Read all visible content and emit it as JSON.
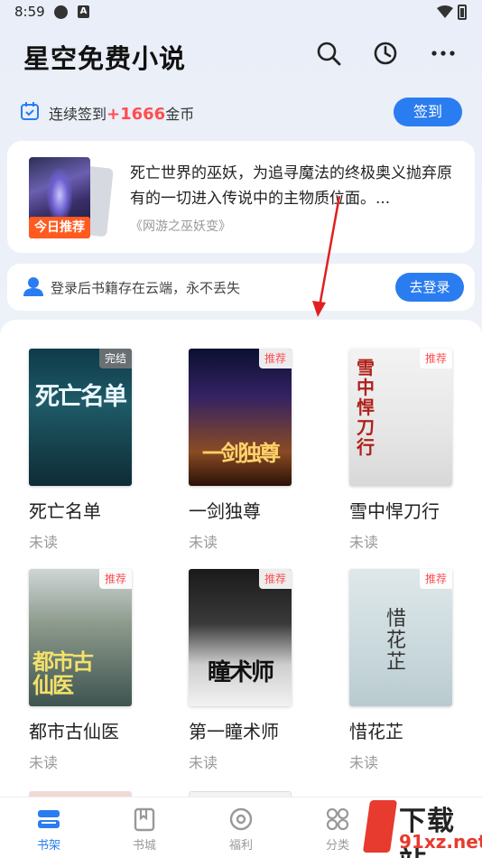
{
  "status_bar": {
    "time": "8:59",
    "notif_icon_1": "globe-icon",
    "notif_icon_2": "A"
  },
  "header": {
    "title": "星空免费小说",
    "icons": [
      "search-icon",
      "history-clock-icon",
      "more-dots-icon"
    ]
  },
  "checkin": {
    "prefix": "连续签到",
    "coins": "+1666",
    "suffix": "金币",
    "button": "签到"
  },
  "recommend": {
    "badge": "今日推荐",
    "description": "死亡世界的巫妖，为追寻魔法的终极奥义抛弃原有的一切进入传说中的主物质位面。...",
    "book": "《网游之巫妖变》"
  },
  "login": {
    "text": "登录后书籍存在云端，永不丢失",
    "button": "去登录"
  },
  "books": [
    {
      "title": "死亡名单",
      "status": "未读",
      "tag": "完结",
      "cover_text": "死亡名单"
    },
    {
      "title": "一剑独尊",
      "status": "未读",
      "tag": "推荐",
      "cover_text": "一剑独尊"
    },
    {
      "title": "雪中悍刀行",
      "status": "未读",
      "tag": "推荐",
      "cover_text": "雪中悍刀行"
    },
    {
      "title": "都市古仙医",
      "status": "未读",
      "tag": "推荐",
      "cover_text": "都市古仙医"
    },
    {
      "title": "第一瞳术师",
      "status": "未读",
      "tag": "推荐",
      "cover_text": "瞳术师"
    },
    {
      "title": "惜花芷",
      "status": "未读",
      "tag": "推荐",
      "cover_text": "惜花芷"
    }
  ],
  "tabs": [
    {
      "label": "书架",
      "icon": "bookshelf-icon",
      "active": true
    },
    {
      "label": "书城",
      "icon": "bookstore-icon",
      "active": false
    },
    {
      "label": "福利",
      "icon": "welfare-icon",
      "active": false
    },
    {
      "label": "分类",
      "icon": "category-icon",
      "active": false
    }
  ],
  "watermark": {
    "line1": "下载站",
    "line2": "91xz.net"
  },
  "colors": {
    "accent": "#2a7df0",
    "coin": "#ff4d4f",
    "badge": "#ff5a1f"
  }
}
